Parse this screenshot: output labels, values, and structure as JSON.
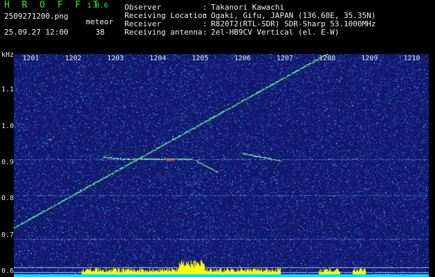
{
  "header": {
    "brand": "H R O F F T",
    "version": "1.0.0",
    "filename": "2509271200.png",
    "datetime": "25.09.27 12:00",
    "mode": "meteor",
    "count": "38"
  },
  "info": [
    {
      "label": "Observer",
      "value": "Takanori Kawachi"
    },
    {
      "label": "Receiving Location",
      "value": "Ogaki, Gifu, JAPAN (136.60E, 35.35N)"
    },
    {
      "label": "Receiver",
      "value": "R820T2(RTL-SDR) SDR-Sharp 53.1000MHz"
    },
    {
      "label": "Receiving antenna",
      "value": "2el-HB9CV Vertical (el. E-W)"
    }
  ],
  "info_colon": ":",
  "colors": {
    "background": "#11186e",
    "noise": "#3a78d8",
    "trace": "#7bf0a0",
    "hot": "#ff4a2a",
    "spectrum": "#ffff00",
    "spectrum_base": "#00e0ff",
    "label_green": "#33ee33"
  },
  "chart_data": {
    "type": "heatmap",
    "ylabel": "kHz",
    "x_ticks": [
      "1201",
      "1202",
      "1203",
      "1204",
      "1205",
      "1206",
      "1207",
      "1208",
      "1209",
      "1210"
    ],
    "y_ticks": [
      "1.1",
      "1.0",
      "0.9",
      "0.8",
      "0.7",
      "0.6"
    ],
    "xlim": [
      1200.6,
      1210.4
    ],
    "ylim": [
      0.585,
      1.2
    ],
    "tracks": [
      {
        "kind": "sweep",
        "x": [
          1200.6,
          1208.0
        ],
        "y": [
          0.72,
          1.2
        ]
      },
      {
        "kind": "echo",
        "x": [
          1203.2,
          1204.8
        ],
        "y": [
          0.91,
          0.91
        ]
      },
      {
        "kind": "echo",
        "x": [
          1204.9,
          1205.4
        ],
        "y": [
          0.905,
          0.875
        ]
      },
      {
        "kind": "echo",
        "x": [
          1206.0,
          1206.9
        ],
        "y": [
          0.925,
          0.905
        ]
      },
      {
        "kind": "echo",
        "x": [
          1202.7,
          1203.2
        ],
        "y": [
          0.915,
          0.91
        ]
      }
    ],
    "hlines": [
      0.91,
      0.81,
      0.69,
      0.612,
      0.598
    ],
    "vband": [
      1204.5,
      1205.3
    ]
  }
}
